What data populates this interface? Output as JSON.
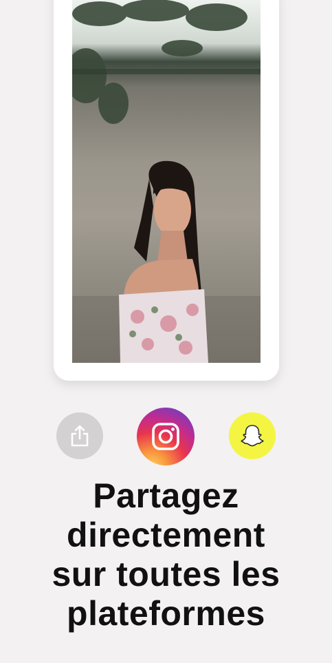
{
  "photo": {
    "subject": "portrait-photo"
  },
  "share": {
    "buttons": [
      {
        "name": "share",
        "icon": "share-upload-icon",
        "color": "#d3d1d2"
      },
      {
        "name": "instagram",
        "icon": "instagram-icon",
        "color": "#e8344f"
      },
      {
        "name": "snapchat",
        "icon": "snapchat-ghost-icon",
        "color": "#f3f542"
      }
    ]
  },
  "headline": {
    "line1": "Partagez",
    "line2": "directement",
    "line3": "sur toutes les",
    "line4": "plateformes"
  },
  "colors": {
    "background": "#f3f1f2",
    "card": "#ffffff",
    "text": "#111111"
  }
}
